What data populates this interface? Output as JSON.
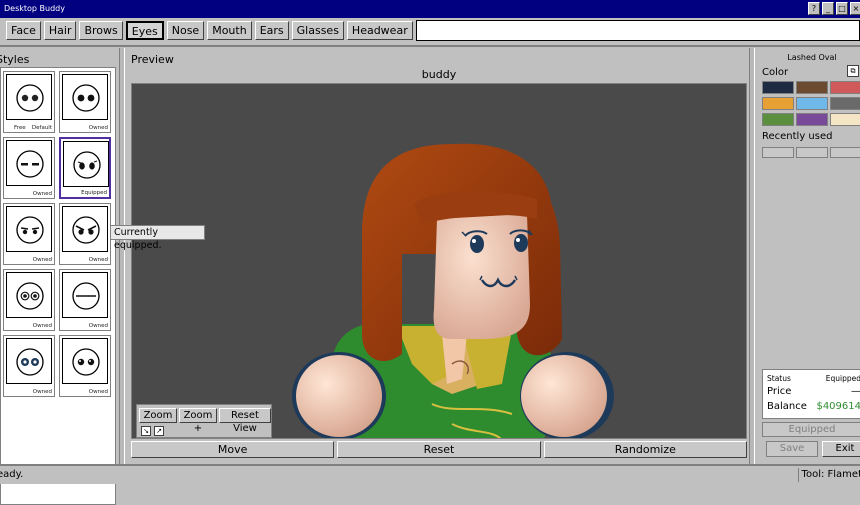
{
  "window": {
    "title": "Desktop Buddy",
    "buttons": [
      "?",
      "_",
      "□",
      "×"
    ]
  },
  "tabs": [
    {
      "label": "Face",
      "active": false
    },
    {
      "label": "Hair",
      "active": false
    },
    {
      "label": "Brows",
      "active": false
    },
    {
      "label": "Eyes",
      "active": true
    },
    {
      "label": "Nose",
      "active": false
    },
    {
      "label": "Mouth",
      "active": false
    },
    {
      "label": "Ears",
      "active": false
    },
    {
      "label": "Glasses",
      "active": false
    },
    {
      "label": "Headwear",
      "active": false
    }
  ],
  "styles": {
    "title": "Styles",
    "cards": [
      {
        "state": "Owned",
        "extra": "Free",
        "state2": "Default"
      },
      {
        "state": "Owned"
      },
      {
        "state": "Owned"
      },
      {
        "state": "Equipped",
        "selected": true
      },
      {
        "state": "Owned"
      },
      {
        "state": "Owned"
      },
      {
        "state": "Owned"
      },
      {
        "state": "Owned"
      },
      {
        "state": "Owned"
      },
      {
        "state": "Owned"
      }
    ],
    "tooltip": "Currently equipped."
  },
  "preview": {
    "title": "Preview",
    "buddy_name": "buddy",
    "zoom_out": "Zoom −",
    "zoom_in": "Zoom +",
    "reset_view": "Reset View",
    "actions": [
      "Move",
      "Reset",
      "Randomize"
    ]
  },
  "details": {
    "item_name": "Lashed Oval",
    "color_label": "Color",
    "swatches": [
      "#1e2b42",
      "#6b4a30",
      "#d05a5a",
      "#e6a033",
      "#6eb8ea",
      "#6a6a6a",
      "#5a8f3d",
      "#7a4a9a",
      "#f4e6c4"
    ],
    "recent_label": "Recently used",
    "status_label": "Status",
    "status_value": "Equipped",
    "price_label": "Price",
    "price_value": "—",
    "balance_label": "Balance",
    "balance_value": "$409614",
    "balance_color": "#2e8b2e",
    "equipped_button": "Equipped",
    "save_button": "Save",
    "exit_button": "Exit"
  },
  "statusbar": {
    "left": "eady.",
    "right": "Tool: Flamet"
  }
}
